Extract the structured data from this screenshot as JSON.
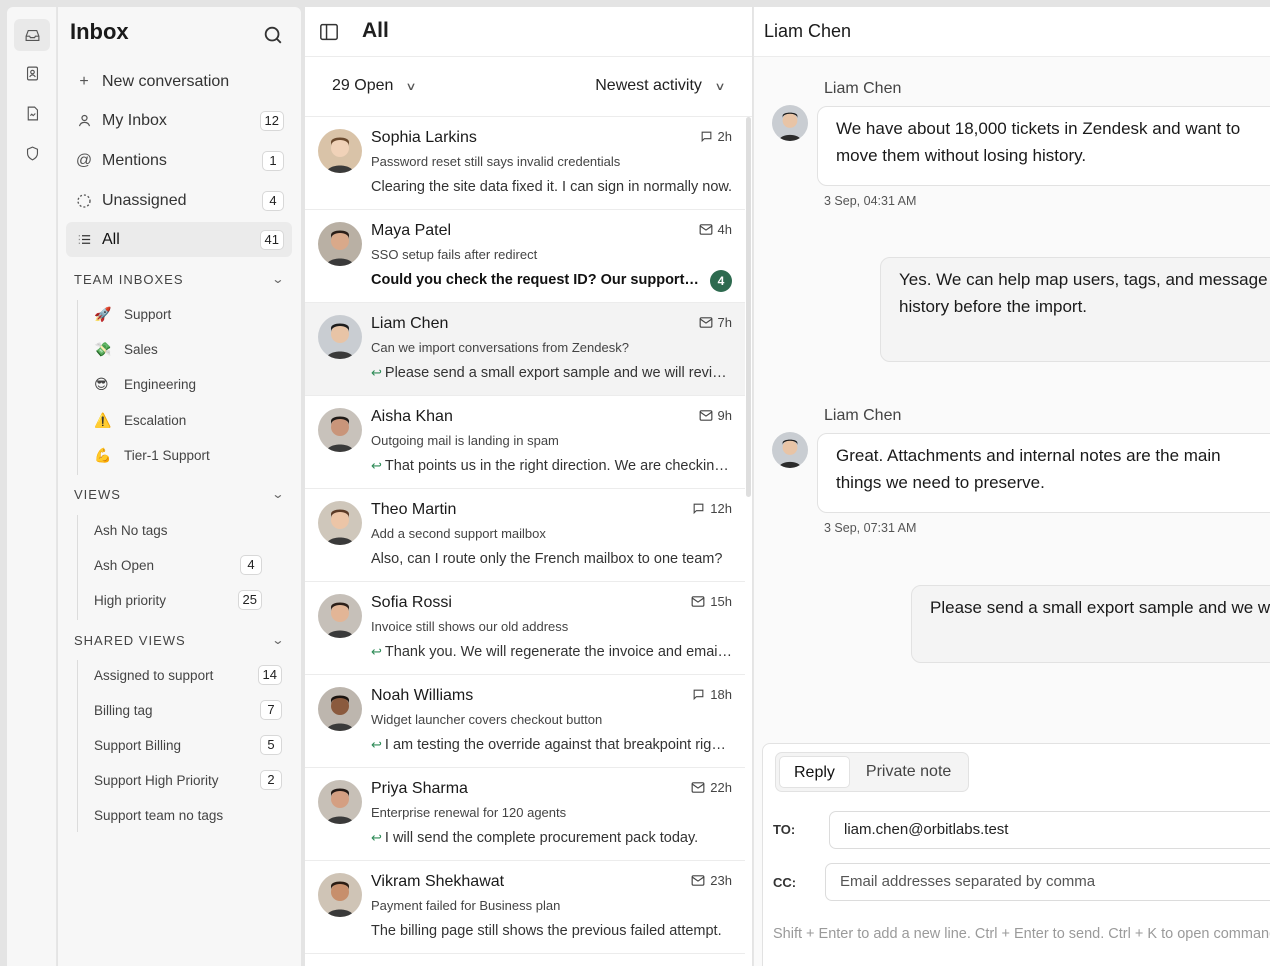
{
  "sidebar": {
    "title": "Inbox",
    "nav": [
      {
        "label": "New conversation",
        "count": null
      },
      {
        "label": "My Inbox",
        "count": "12"
      },
      {
        "label": "Mentions",
        "count": "1"
      },
      {
        "label": "Unassigned",
        "count": "4"
      },
      {
        "label": "All",
        "count": "41"
      }
    ],
    "team_inboxes": {
      "heading": "TEAM INBOXES",
      "items": [
        {
          "emoji": "🚀",
          "label": "Support"
        },
        {
          "emoji": "💸",
          "label": "Sales"
        },
        {
          "emoji": "😎",
          "label": "Engineering"
        },
        {
          "emoji": "⚠️",
          "label": "Escalation"
        },
        {
          "emoji": "💪",
          "label": "Tier-1 Support"
        }
      ]
    },
    "views": {
      "heading": "VIEWS",
      "items": [
        {
          "label": "Ash No tags",
          "count": null
        },
        {
          "label": "Ash Open",
          "count": "4"
        },
        {
          "label": "High priority",
          "count": "25"
        }
      ]
    },
    "shared_views": {
      "heading": "SHARED VIEWS",
      "items": [
        {
          "label": "Assigned to support",
          "count": "14"
        },
        {
          "label": "Billing tag",
          "count": "7"
        },
        {
          "label": "Support Billing",
          "count": "5"
        },
        {
          "label": "Support High Priority",
          "count": "2"
        },
        {
          "label": "Support team no tags",
          "count": null
        }
      ]
    }
  },
  "list": {
    "title": "All",
    "status_filter": "29 Open",
    "sort": "Newest activity",
    "conversations": [
      {
        "name": "Sophia Larkins",
        "channel_icon": "chat-icon",
        "time": "2h",
        "subject": "Password reset still says invalid credentials",
        "preview": "Clearing the site data fixed it. I can sign in normally now.",
        "replied": false,
        "bold": false,
        "unread": null
      },
      {
        "name": "Maya Patel",
        "channel_icon": "mail-icon",
        "time": "4h",
        "subject": "SSO setup fails after redirect",
        "preview": "Could you check the request ID? Our support team is waiting.",
        "replied": false,
        "bold": true,
        "unread": "4"
      },
      {
        "name": "Liam Chen",
        "channel_icon": "mail-icon",
        "time": "7h",
        "subject": "Can we import conversations from Zendesk?",
        "preview": "Please send a small export sample and we will review the mapping.",
        "replied": true,
        "bold": false,
        "unread": null
      },
      {
        "name": "Aisha Khan",
        "channel_icon": "mail-icon",
        "time": "9h",
        "subject": "Outgoing mail is landing in spam",
        "preview": "That points us in the right direction. We are checking the DNS records.",
        "replied": true,
        "bold": false,
        "unread": null
      },
      {
        "name": "Theo Martin",
        "channel_icon": "chat-icon",
        "time": "12h",
        "subject": "Add a second support mailbox",
        "preview": "Also, can I route only the French mailbox to one team?",
        "replied": false,
        "bold": false,
        "unread": null
      },
      {
        "name": "Sofia Rossi",
        "channel_icon": "mail-icon",
        "time": "15h",
        "subject": "Invoice still shows our old address",
        "preview": "Thank you. We will regenerate the invoice and email it to you.",
        "replied": true,
        "bold": false,
        "unread": null
      },
      {
        "name": "Noah Williams",
        "channel_icon": "chat-icon",
        "time": "18h",
        "subject": "Widget launcher covers checkout button",
        "preview": "I am testing the override against that breakpoint right now.",
        "replied": true,
        "bold": false,
        "unread": null
      },
      {
        "name": "Priya Sharma",
        "channel_icon": "mail-icon",
        "time": "22h",
        "subject": "Enterprise renewal for 120 agents",
        "preview": "I will send the complete procurement pack today.",
        "replied": true,
        "bold": false,
        "unread": null
      },
      {
        "name": "Vikram Shekhawat",
        "channel_icon": "mail-icon",
        "time": "23h",
        "subject": "Payment failed for Business plan",
        "preview": "The billing page still shows the previous failed attempt.",
        "replied": false,
        "bold": false,
        "unread": null
      }
    ]
  },
  "detail": {
    "title": "Liam Chen",
    "messages": [
      {
        "author": "Liam Chen",
        "text": "We have about 18,000 tickets in Zendesk and want to move them without losing history.",
        "time": "3 Sep, 04:31 AM",
        "outgoing": false
      },
      {
        "author": "",
        "text": "Yes. We can help map users, tags, and message history before the import.",
        "time": "",
        "outgoing": true
      },
      {
        "author": "Liam Chen",
        "text": "Great. Attachments and internal notes are the main things we need to preserve.",
        "time": "3 Sep, 07:31 AM",
        "outgoing": false
      },
      {
        "author": "",
        "text": "Please send a small export sample and we will review the mapping.",
        "time": "",
        "outgoing": true
      }
    ],
    "composer": {
      "tab_reply": "Reply",
      "tab_note": "Private note",
      "to_label": "TO:",
      "to_value": "liam.chen@orbitlabs.test",
      "cc_label": "CC:",
      "cc_placeholder": "Email addresses separated by comma",
      "hint": "Shift + Enter to add a new line. Ctrl + Enter to send. Ctrl + K to open commands."
    }
  },
  "colors": {
    "accent_green": "#2d6a4f",
    "reply_arrow": "#2e8b57"
  }
}
